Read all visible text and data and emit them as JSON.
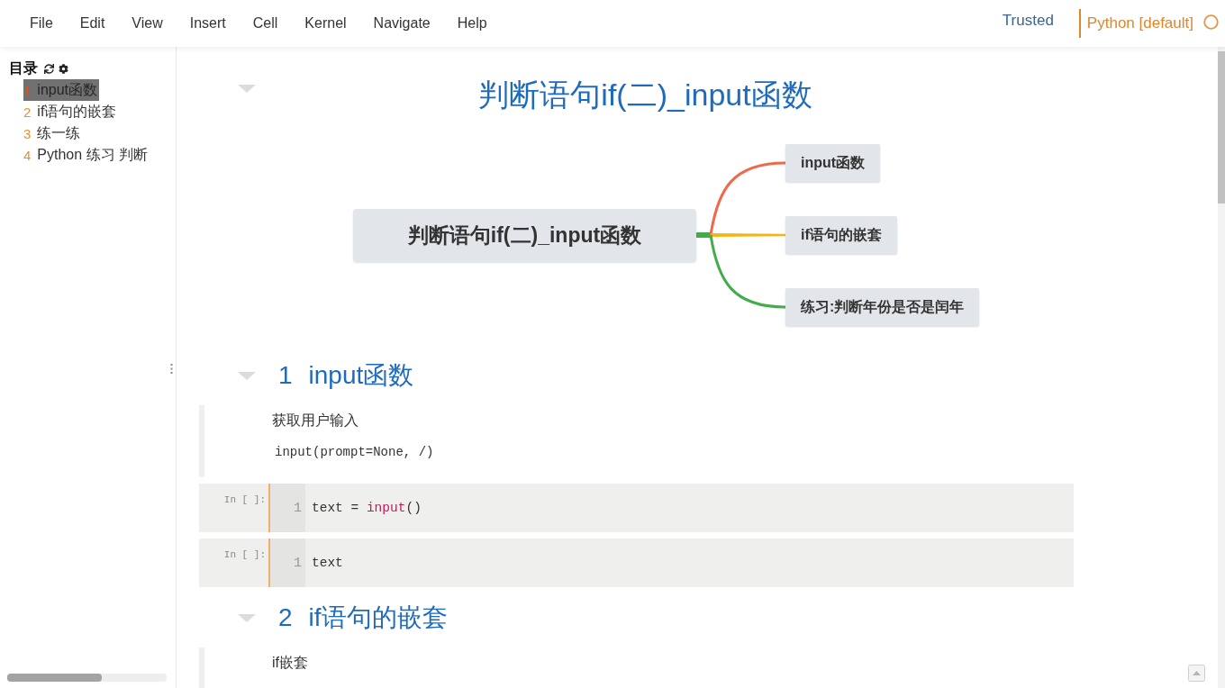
{
  "menu_bar": {
    "items": [
      "File",
      "Edit",
      "View",
      "Insert",
      "Cell",
      "Kernel",
      "Navigate",
      "Help"
    ],
    "trusted": "Trusted",
    "kernel": "Python [default]"
  },
  "toc": {
    "title": "目录",
    "items": [
      {
        "number": "1",
        "label": "input函数",
        "selected": true
      },
      {
        "number": "2",
        "label": "if语句的嵌套",
        "selected": false
      },
      {
        "number": "3",
        "label": "练一练",
        "selected": false
      },
      {
        "number": "4",
        "label": "Python 练习 判断",
        "selected": false
      }
    ]
  },
  "notebook": {
    "cells": [
      {
        "kind": "title",
        "text": "判断语句if(二)_input函数"
      },
      {
        "kind": "mindmap",
        "root": "判断语句if(二)_input函数",
        "branches": [
          {
            "label": "input函数",
            "color": "#ef6a4c"
          },
          {
            "label": "if语句的嵌套",
            "color": "#f3b512"
          },
          {
            "label": "练习:判断年份是否是闰年",
            "color": "#43ad4b"
          }
        ]
      },
      {
        "kind": "heading",
        "number": "1",
        "text": "input函数"
      },
      {
        "kind": "markdown",
        "paragraphs": [
          {
            "kind": "text",
            "text": "获取用户输入"
          },
          {
            "kind": "code",
            "text": "input(prompt=None, /)"
          }
        ]
      },
      {
        "kind": "code",
        "prompt": "In [ ]:",
        "lines": [
          {
            "number": "1",
            "tokens": [
              {
                "kind": "plain",
                "text": "text = "
              },
              {
                "kind": "builtin",
                "text": "input"
              },
              {
                "kind": "plain",
                "text": "()"
              }
            ]
          }
        ]
      },
      {
        "kind": "code",
        "prompt": "In [ ]:",
        "lines": [
          {
            "number": "1",
            "tokens": [
              {
                "kind": "plain",
                "text": "text"
              }
            ]
          }
        ]
      },
      {
        "kind": "heading",
        "number": "2",
        "text": "if语句的嵌套"
      },
      {
        "kind": "markdown",
        "paragraphs": [
          {
            "kind": "text",
            "text": "if嵌套"
          }
        ]
      }
    ]
  }
}
